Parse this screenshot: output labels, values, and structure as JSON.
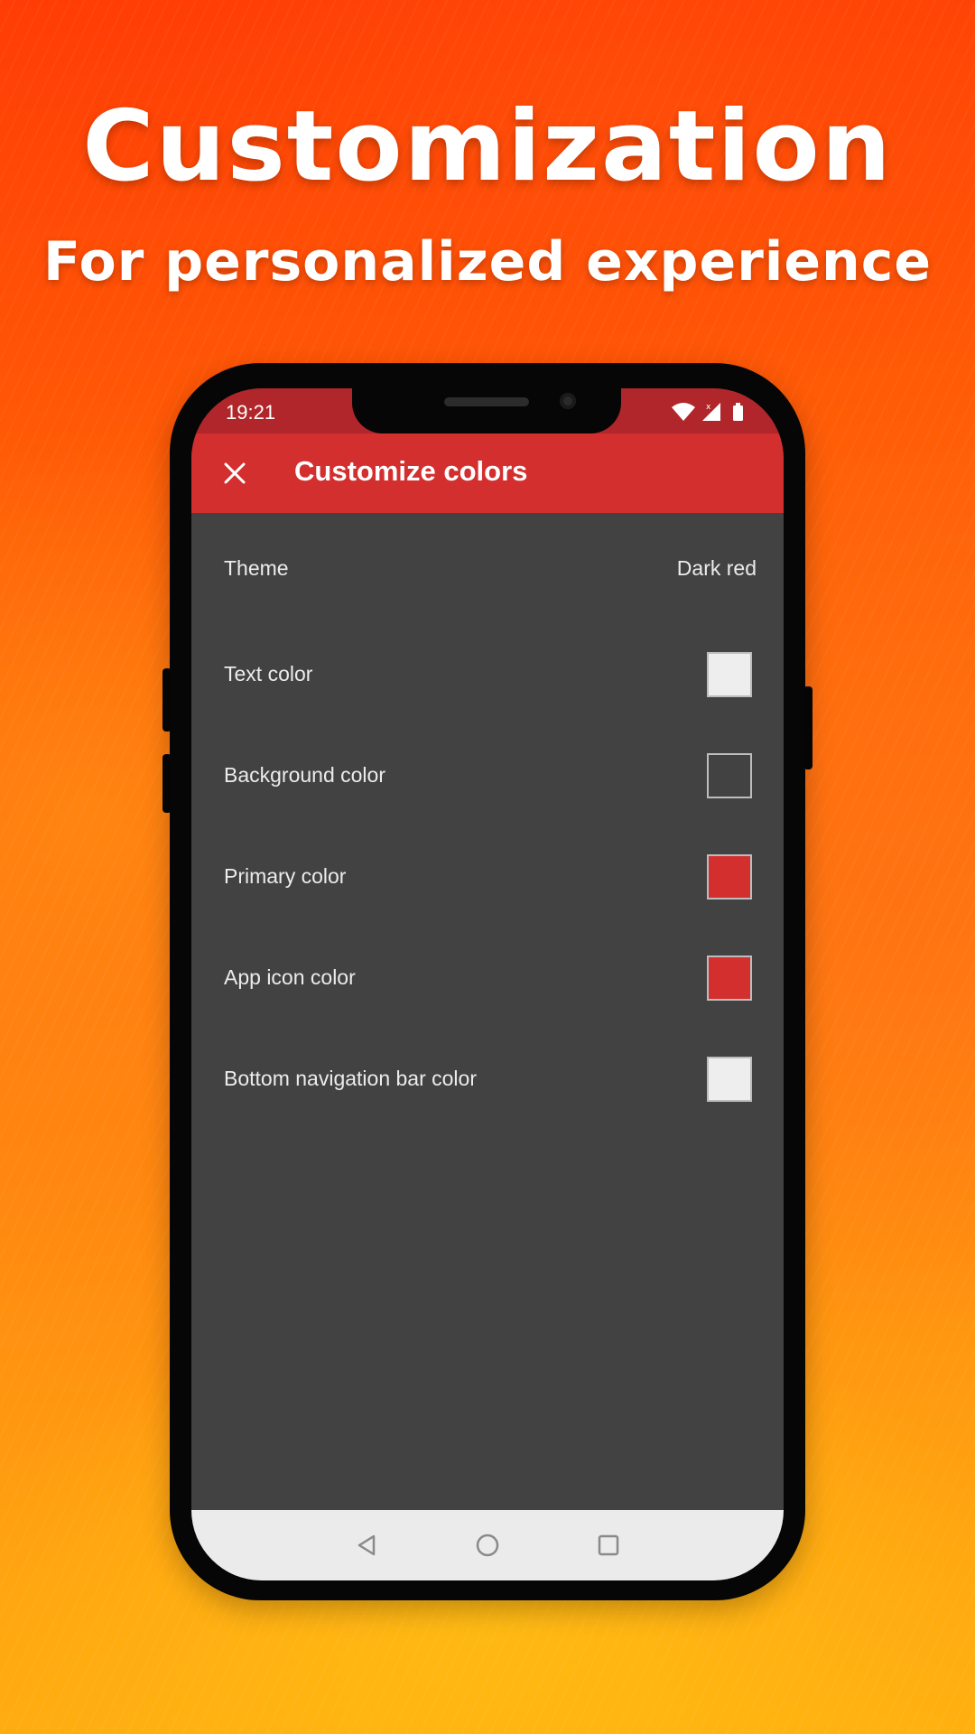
{
  "promo": {
    "title": "Customization",
    "subtitle": "For personalized experience"
  },
  "status_bar": {
    "time": "19:21",
    "icons": [
      "wifi-icon",
      "signal-icon",
      "battery-icon"
    ]
  },
  "toolbar": {
    "close_icon": "close-icon",
    "title": "Customize colors"
  },
  "settings": {
    "theme": {
      "label": "Theme",
      "value": "Dark red"
    },
    "text_color": {
      "label": "Text color",
      "color": "#eeeeee"
    },
    "background_color": {
      "label": "Background color",
      "color": "#424242"
    },
    "primary_color": {
      "label": "Primary color",
      "color": "#d32f2f"
    },
    "app_icon_color": {
      "label": "App icon color",
      "color": "#d32f2f"
    },
    "bottom_nav_color": {
      "label": "Bottom navigation bar color",
      "color": "#eeeeee"
    }
  },
  "nav_bar": {
    "icons": [
      "back-icon",
      "home-icon",
      "recents-icon"
    ]
  },
  "colors": {
    "toolbar": "#d32f2f",
    "status_bar": "#b0262a",
    "screen_background": "#424242",
    "promo_background": "#ff6a0a"
  }
}
